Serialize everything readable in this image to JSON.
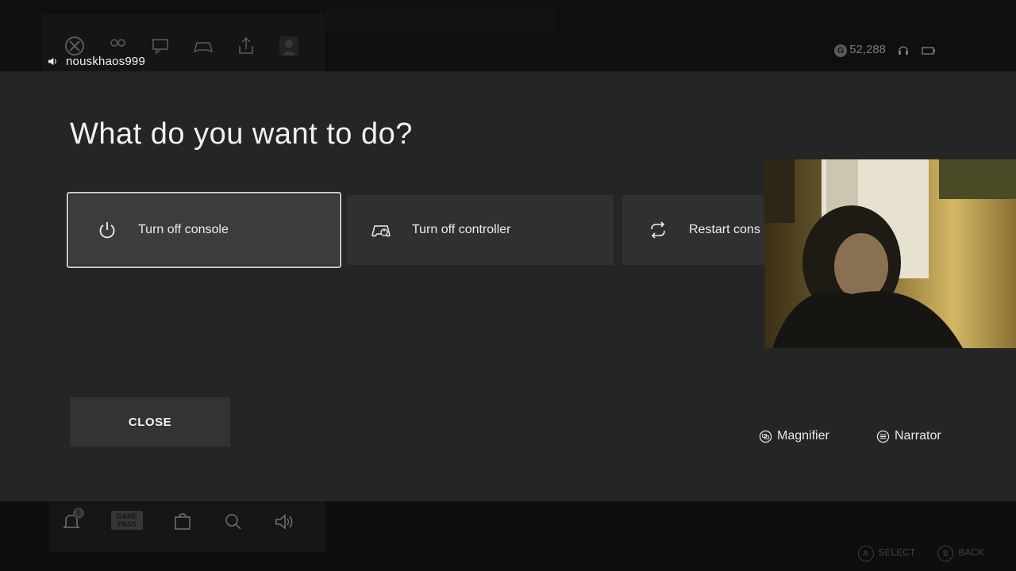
{
  "user": {
    "gamertag": "nouskhaos999",
    "gamerscore": "52,288"
  },
  "dialog": {
    "title": "What do you want to do?",
    "options": [
      {
        "label": "Turn off console",
        "icon": "power-icon",
        "selected": true
      },
      {
        "label": "Turn off controller",
        "icon": "controller-icon",
        "selected": false
      },
      {
        "label": "Restart cons",
        "icon": "restart-icon",
        "selected": false
      }
    ],
    "close_label": "CLOSE",
    "accessibility": {
      "magnifier_label": "Magnifier",
      "narrator_label": "Narrator"
    }
  },
  "bottom_bar": {
    "notification_count": "6",
    "game_pass_logo": [
      "GAME",
      "PASS"
    ],
    "hints": [
      "SELECT",
      "BACK"
    ]
  },
  "colors": {
    "overlay_bg": "#252525",
    "option_bg": "#303030",
    "option_selected_bg": "#3c3c3c",
    "selected_border": "#c9c9c9",
    "button_bg": "#333333"
  }
}
